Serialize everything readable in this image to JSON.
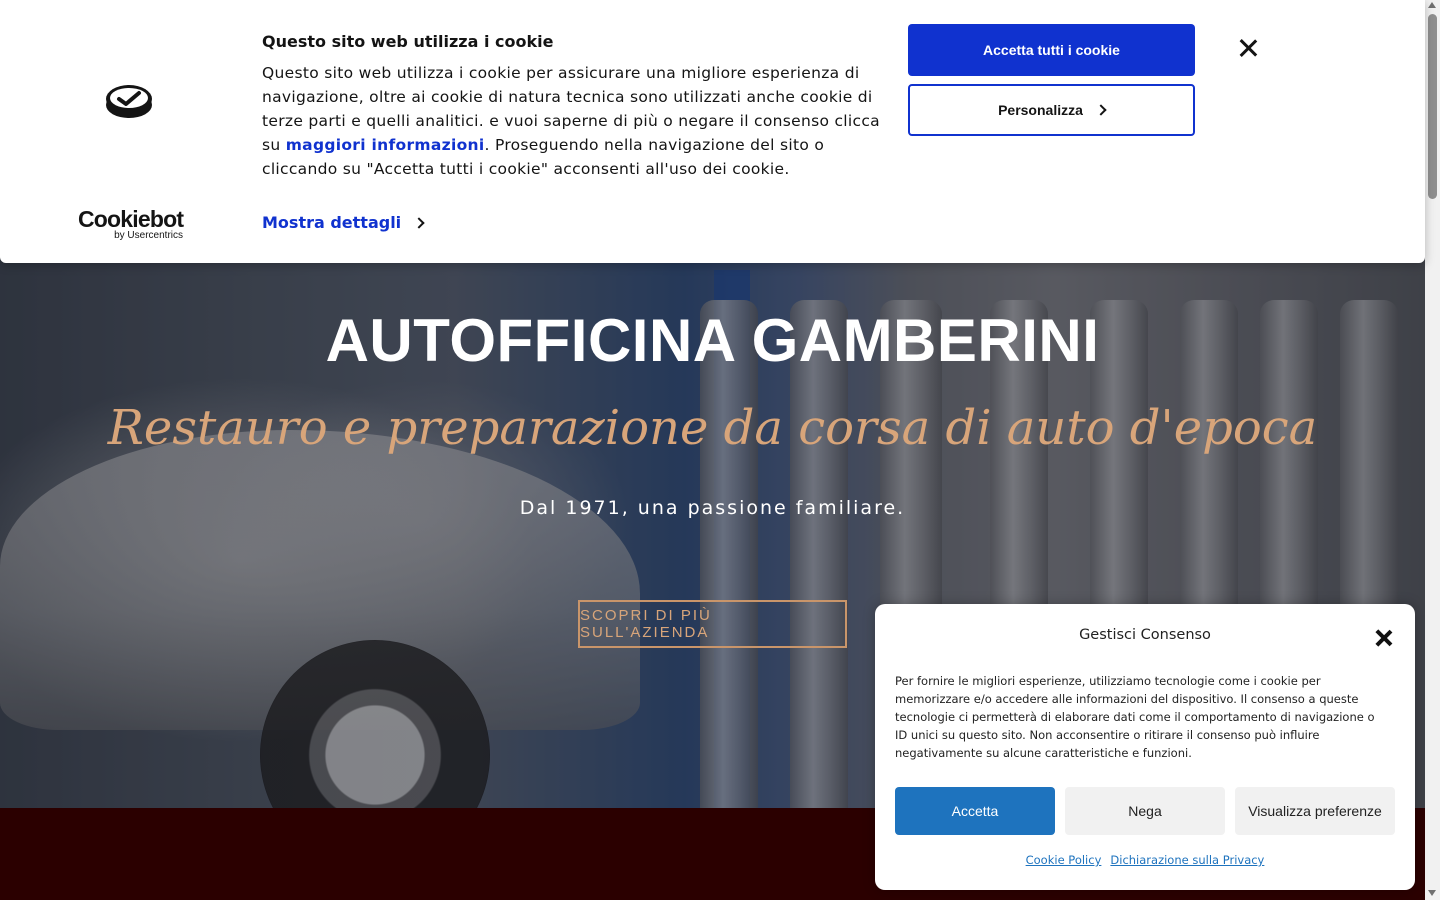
{
  "hero": {
    "title": "AUTOFFICINA GAMBERINI",
    "subtitle": "Restauro e preparazione da corsa di auto d'epoca",
    "tagline": "Dal 1971, una passione familiare.",
    "cta": "SCOPRI DI PIÙ SULL'AZIENDA"
  },
  "cookiebot": {
    "title": "Questo sito web utilizza i cookie",
    "text_before": "Questo sito web utilizza i cookie per assicurare una migliore esperienza di navigazione, oltre ai cookie di natura tecnica sono utilizzati anche cookie di terze parti e quelli analitici. e vuoi saperne di più o negare il consenso clicca su ",
    "text_link": "maggiori informazioni",
    "text_after": ". Proseguendo nella navigazione del sito o cliccando su \"Accetta tutti i cookie\" acconsenti all'uso dei cookie.",
    "details": "Mostra dettagli",
    "accept_all": "Accetta tutti i cookie",
    "customize": "Personalizza",
    "brand_name": "Cookiebot",
    "brand_by": "by Usercentrics",
    "accent_color": "#1032cf"
  },
  "consent_manager": {
    "title": "Gestisci Consenso",
    "text": "Per fornire le migliori esperienze, utilizziamo tecnologie come i cookie per memorizzare e/o accedere alle informazioni del dispositivo. Il consenso a queste tecnologie ci permetterà di elaborare dati come il comportamento di navigazione o ID unici su questo sito. Non acconsentire o ritirare il consenso può influire negativamente su alcune caratteristiche e funzioni.",
    "accept": "Accetta",
    "deny": "Nega",
    "preferences": "Visualizza preferenze",
    "cookie_policy": "Cookie Policy",
    "privacy": "Dichiarazione sulla Privacy",
    "accent_color": "#1e73be"
  },
  "icons": {
    "close": "close-icon",
    "chevron": "chevron-right-icon",
    "logo": "cookiebot-logo-icon"
  }
}
